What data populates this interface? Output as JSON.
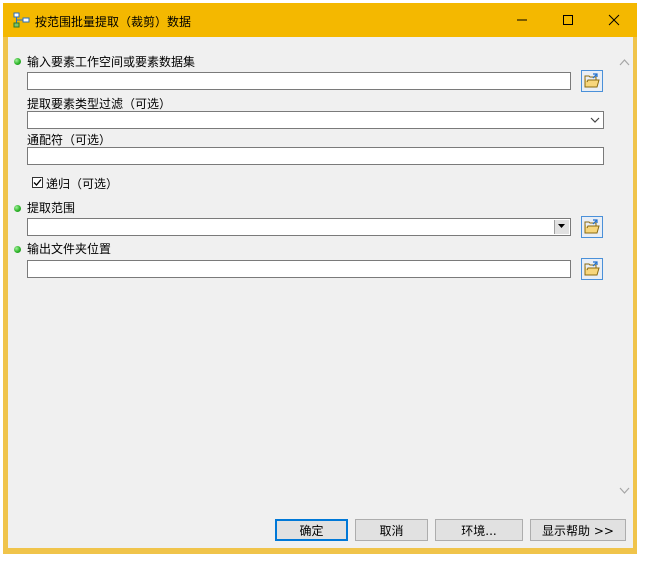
{
  "window": {
    "title": "按范围批量提取（裁剪）数据",
    "icons": [
      "model-tool-icon",
      "minimize-icon",
      "maximize-icon",
      "close-icon"
    ]
  },
  "form": {
    "input_workspace": {
      "label": "输入要素工作空间或要素数据集",
      "value": "",
      "required": true
    },
    "type_filter": {
      "label": "提取要素类型过滤（可选）",
      "value": ""
    },
    "wildcard": {
      "label": "通配符（可选）",
      "value": ""
    },
    "recursive": {
      "label": "递归（可选）",
      "checked": true
    },
    "extent": {
      "label": "提取范围",
      "value": "",
      "required": true
    },
    "output_folder": {
      "label": "输出文件夹位置",
      "value": "",
      "required": true
    }
  },
  "buttons": {
    "ok": "确定",
    "cancel": "取消",
    "environments": "环境...",
    "show_help": "显示帮助 >>"
  },
  "colors": {
    "titlebar": "#f4b800",
    "required_dot": "#2fb52a",
    "default_button_border": "#0078d7"
  }
}
